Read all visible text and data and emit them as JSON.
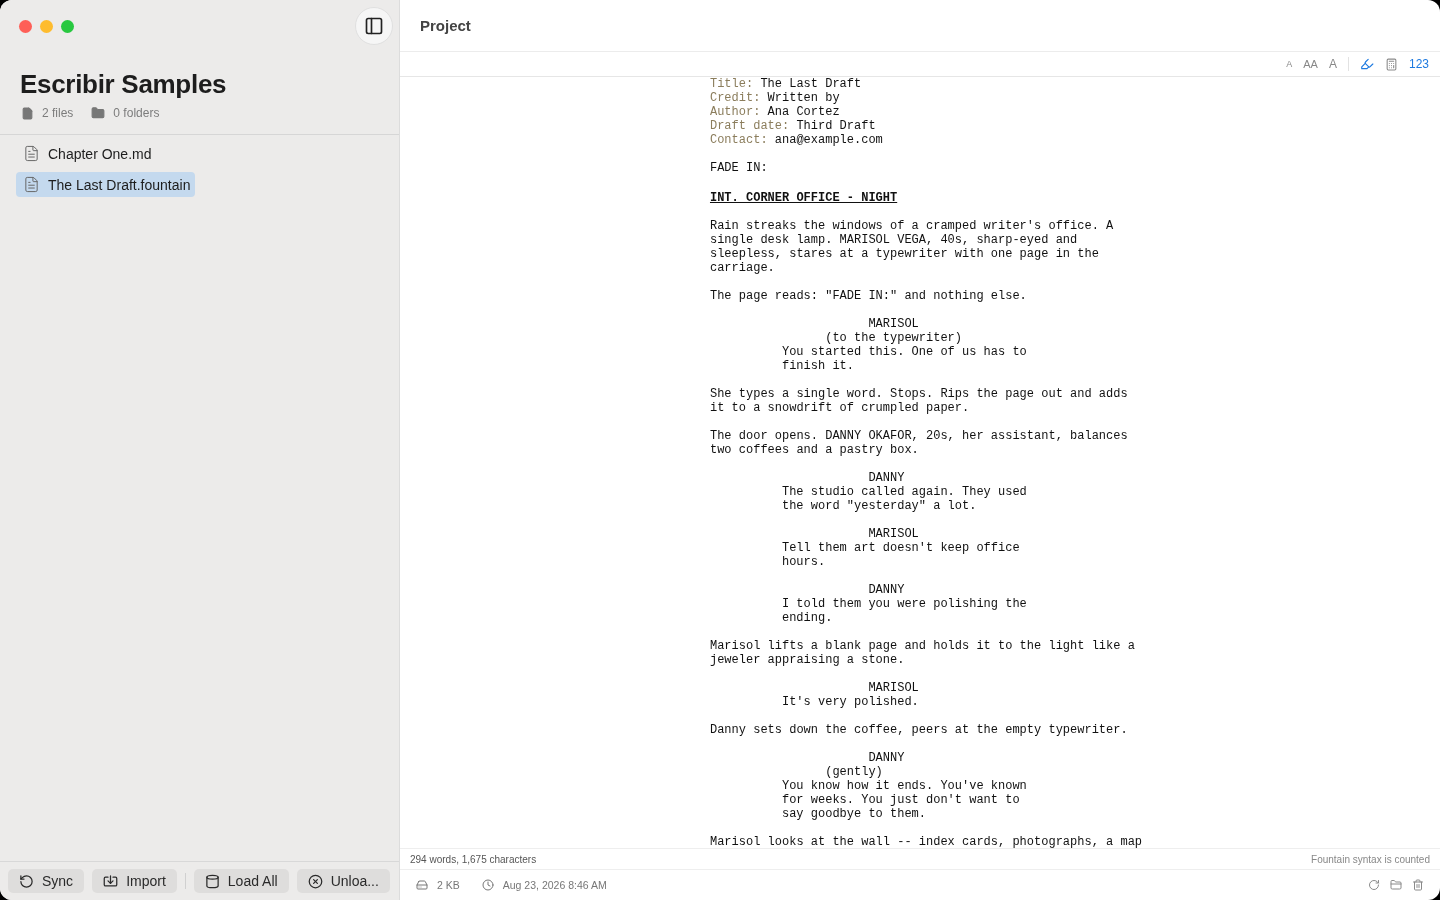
{
  "sidebar": {
    "title": "Escribir Samples",
    "stats": [
      {
        "kind": "file",
        "label": "2 files"
      },
      {
        "kind": "folder",
        "label": "0 folders"
      }
    ],
    "files": [
      {
        "name": "Chapter One.md",
        "selected": false
      },
      {
        "name": "The Last Draft.fountain",
        "selected": true
      }
    ],
    "actions": [
      {
        "kind": "sync",
        "label": "Sync"
      },
      {
        "kind": "import",
        "label": "Import"
      },
      {
        "kind": "load",
        "label": "Load All"
      },
      {
        "kind": "unload",
        "label": "Unloa..."
      }
    ]
  },
  "header": {
    "title": "Project"
  },
  "toolbar": {
    "font_sizes": [
      "A",
      "AA",
      "A"
    ],
    "highlight_on": true,
    "counter": "123"
  },
  "script": [
    {
      "kind": "title_field",
      "key": "Title:",
      "value": "The Last Draft"
    },
    {
      "kind": "title_field",
      "key": "Credit:",
      "value": "Written by"
    },
    {
      "kind": "title_field",
      "key": "Author:",
      "value": "Ana Cortez"
    },
    {
      "kind": "title_field",
      "key": "Draft date:",
      "value": "Third Draft"
    },
    {
      "kind": "title_field",
      "key": "Contact:",
      "value": "ana@example.com"
    },
    {
      "kind": "transition",
      "text": "FADE IN:"
    },
    {
      "kind": "scene_heading",
      "text": "INT. CORNER OFFICE - NIGHT"
    },
    {
      "kind": "action",
      "text": "Rain streaks the windows of a cramped writer's office. A single desk lamp. MARISOL VEGA, 40s, sharp-eyed and sleepless, stares at a typewriter with one page in the carriage."
    },
    {
      "kind": "action",
      "text": "The page reads: \"FADE IN:\" and nothing else."
    },
    {
      "kind": "character",
      "text": "MARISOL"
    },
    {
      "kind": "parenthetical",
      "text": "(to the typewriter)"
    },
    {
      "kind": "dialogue",
      "text": "You started this. One of us has to finish it."
    },
    {
      "kind": "action",
      "text": "She types a single word. Stops. Rips the page out and adds it to a snowdrift of crumpled paper."
    },
    {
      "kind": "action",
      "text": "The door opens. DANNY OKAFOR, 20s, her assistant, balances two coffees and a pastry box."
    },
    {
      "kind": "character",
      "text": "DANNY"
    },
    {
      "kind": "dialogue",
      "text": "The studio called again. They used the word \"yesterday\" a lot."
    },
    {
      "kind": "character",
      "text": "MARISOL"
    },
    {
      "kind": "dialogue",
      "text": "Tell them art doesn't keep office hours."
    },
    {
      "kind": "character",
      "text": "DANNY"
    },
    {
      "kind": "dialogue",
      "text": "I told them you were polishing the ending."
    },
    {
      "kind": "action",
      "text": "Marisol lifts a blank page and holds it to the light like a jeweler appraising a stone."
    },
    {
      "kind": "character",
      "text": "MARISOL"
    },
    {
      "kind": "dialogue",
      "text": "It's very polished."
    },
    {
      "kind": "action",
      "text": "Danny sets down the coffee, peers at the empty typewriter."
    },
    {
      "kind": "character",
      "text": "DANNY"
    },
    {
      "kind": "parenthetical",
      "text": "(gently)"
    },
    {
      "kind": "dialogue",
      "text": "You know how it ends. You've known for weeks. You just don't want to say goodbye to them."
    },
    {
      "kind": "action",
      "text": "Marisol looks at the wall -- index cards, photographs, a map"
    }
  ],
  "status": {
    "counts": "294 words, 1,675 characters",
    "note": "Fountain syntax is counted"
  },
  "footer": {
    "size": "2 KB",
    "modified": "Aug 23, 2026 8:46 AM"
  }
}
